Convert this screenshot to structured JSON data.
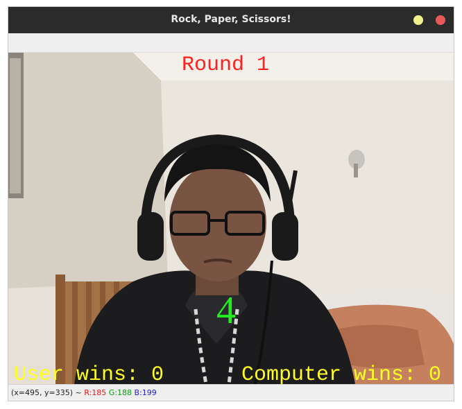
{
  "window": {
    "title": "Rock, Paper, Scissors!"
  },
  "overlay": {
    "round": "Round 1",
    "countdown": "4",
    "user_wins": "User wins: 0",
    "computer_wins": "Computer wins: 0"
  },
  "status": {
    "coords": "(x=495, y=335) ~",
    "r": "R:185",
    "g": "G:188",
    "b": "B:199"
  },
  "colors": {
    "round_text": "#ff2020",
    "countdown_text": "#22ee22",
    "score_text": "#ffff22",
    "titlebar": "#2b2b2b"
  }
}
